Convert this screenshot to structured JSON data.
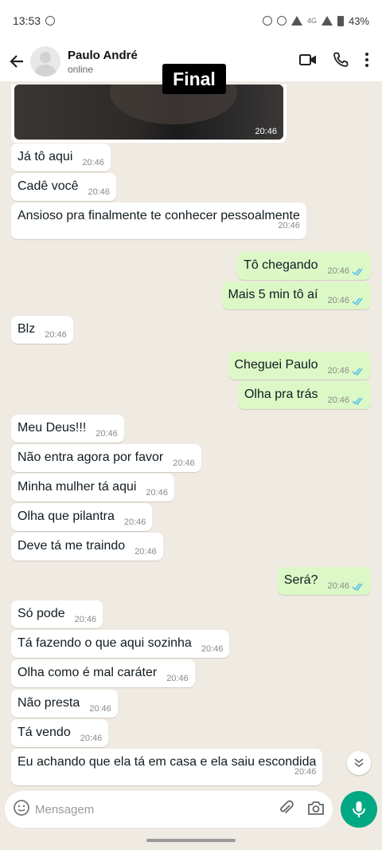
{
  "status_bar": {
    "time": "13:53",
    "battery": "43%",
    "network": "4G"
  },
  "header": {
    "contact_name": "Paulo André",
    "contact_status": "online"
  },
  "overlay_label": "Final",
  "media": {
    "time": "20:46"
  },
  "messages": [
    {
      "dir": "in",
      "text": "Já tô aqui",
      "time": "20:46"
    },
    {
      "dir": "in",
      "text": "Cadê você",
      "time": "20:46"
    },
    {
      "dir": "in",
      "text": "Ansioso pra finalmente te conhecer pessoalmente",
      "time": "20:46"
    },
    {
      "dir": "out",
      "text": "Tô chegando",
      "time": "20:46",
      "read": true
    },
    {
      "dir": "out",
      "text": "Mais 5 min tô aí",
      "time": "20:46",
      "read": true
    },
    {
      "dir": "in",
      "text": "Blz",
      "time": "20:46"
    },
    {
      "dir": "out",
      "text": "Cheguei Paulo",
      "time": "20:46",
      "read": true
    },
    {
      "dir": "out",
      "text": "Olha pra trás",
      "time": "20:46",
      "read": true
    },
    {
      "dir": "in",
      "text": "Meu Deus!!!",
      "time": "20:46"
    },
    {
      "dir": "in",
      "text": "Não entra agora por favor",
      "time": "20:46"
    },
    {
      "dir": "in",
      "text": "Minha mulher tá aqui",
      "time": "20:46"
    },
    {
      "dir": "in",
      "text": "Olha que pilantra",
      "time": "20:46"
    },
    {
      "dir": "in",
      "text": "Deve tá me traindo",
      "time": "20:46"
    },
    {
      "dir": "out",
      "text": "Será?",
      "time": "20:46",
      "read": true
    },
    {
      "dir": "in",
      "text": "Só pode",
      "time": "20:46"
    },
    {
      "dir": "in",
      "text": "Tá fazendo o que aqui sozinha",
      "time": "20:46"
    },
    {
      "dir": "in",
      "text": "Olha como é mal caráter",
      "time": "20:46"
    },
    {
      "dir": "in",
      "text": "Não presta",
      "time": "20:46"
    },
    {
      "dir": "in",
      "text": "Tá vendo",
      "time": "20:46"
    },
    {
      "dir": "in",
      "text": "Eu achando que ela tá em casa e ela saiu escondida",
      "time": "20:46"
    }
  ],
  "input": {
    "placeholder": "Mensagem",
    "value": ""
  },
  "colors": {
    "accent": "#00a884",
    "outgoing_bubble": "#dcf8c6",
    "read_tick": "#53bdeb",
    "chat_bg": "#efeae2"
  },
  "icons": [
    "back-arrow-icon",
    "video-call-icon",
    "phone-icon",
    "more-options-icon",
    "emoji-icon",
    "attach-icon",
    "camera-icon",
    "mic-icon",
    "chevron-double-down-icon"
  ]
}
